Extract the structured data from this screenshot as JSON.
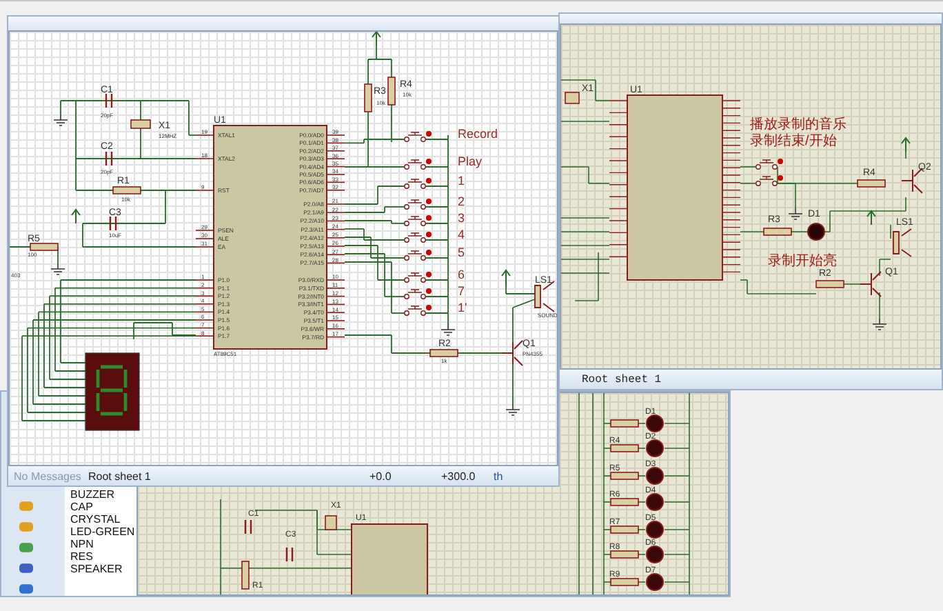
{
  "front_window": {
    "labels": [
      "C1",
      "20pF",
      "C2",
      "20pF",
      "X1",
      "12MHZ",
      "R1",
      "10k",
      "C3",
      "10uF",
      "R5",
      "100",
      "403",
      "R3",
      "10k",
      "R4",
      "10k",
      "U1",
      "AT89C51",
      "R2",
      "1k",
      "Q1",
      "PN4355",
      "LS1",
      "SOUND"
    ],
    "chip": {
      "left_pins": [
        {
          "name": "XTAL1",
          "number": "19"
        },
        {
          "name": "XTAL2",
          "number": "18"
        },
        {
          "name": "RST",
          "number": "9"
        },
        {
          "name": "PSEN",
          "number": "29"
        },
        {
          "name": "ALE",
          "number": "30"
        },
        {
          "name": "EA",
          "number": "31"
        },
        {
          "name": "P1.0",
          "number": "1"
        },
        {
          "name": "P1.1",
          "number": "2"
        },
        {
          "name": "P1.2",
          "number": "3"
        },
        {
          "name": "P1.3",
          "number": "4"
        },
        {
          "name": "P1.4",
          "number": "5"
        },
        {
          "name": "P1.5",
          "number": "6"
        },
        {
          "name": "P1.6",
          "number": "7"
        },
        {
          "name": "P1.7",
          "number": "8"
        }
      ],
      "right_pins": [
        {
          "name": "P0.0/AD0",
          "number": "39"
        },
        {
          "name": "P0.1/AD1",
          "number": "38"
        },
        {
          "name": "P0.2/AD2",
          "number": "37"
        },
        {
          "name": "P0.3/AD3",
          "number": "36"
        },
        {
          "name": "P0.4/AD4",
          "number": "35"
        },
        {
          "name": "P0.5/AD5",
          "number": "34"
        },
        {
          "name": "P0.6/AD6",
          "number": "33"
        },
        {
          "name": "P0.7/AD7",
          "number": "32"
        },
        {
          "name": "P2.0/A8",
          "number": "21"
        },
        {
          "name": "P2.1/A9",
          "number": "22"
        },
        {
          "name": "P2.2/A10",
          "number": "23"
        },
        {
          "name": "P2.3/A11",
          "number": "24"
        },
        {
          "name": "P2.4/A12",
          "number": "25"
        },
        {
          "name": "P2.5/A13",
          "number": "26"
        },
        {
          "name": "P2.6/A14",
          "number": "27"
        },
        {
          "name": "P2.7/A15",
          "number": "28"
        },
        {
          "name": "P3.0/RXD",
          "number": "10"
        },
        {
          "name": "P3.1/TXD",
          "number": "11"
        },
        {
          "name": "P3.2/INT0",
          "number": "12"
        },
        {
          "name": "P3.3/INT1",
          "number": "13"
        },
        {
          "name": "P3.4/T0",
          "number": "14"
        },
        {
          "name": "P3.5/T1",
          "number": "15"
        },
        {
          "name": "P3.6/WR",
          "number": "16"
        },
        {
          "name": "P3.7/RD",
          "number": "17"
        }
      ]
    },
    "buttons": [
      "Record",
      "Play",
      "1",
      "2",
      "3",
      "4",
      "5",
      "6",
      "7",
      "1'"
    ],
    "status_bar": {
      "message": "No Messages",
      "sheet": "Root sheet 1",
      "x": "+0.0",
      "y": "+300.0",
      "unit": "th"
    }
  },
  "back_window": {
    "notes": [
      "播放录制的音乐",
      "录制结束/开始",
      "录制开始亮"
    ],
    "labels": [
      "X1",
      "U1",
      "R4",
      "Q2",
      "R3",
      "D1",
      "LS1",
      "R2",
      "Q1"
    ],
    "status_bar": {
      "sheet": "Root sheet 1"
    }
  },
  "bottom_window": {
    "devices": [
      "BUZZER",
      "CAP",
      "CRYSTAL",
      "LED-GREEN",
      "NPN",
      "RES",
      "SPEAKER"
    ],
    "labels": [
      "C1",
      "X1",
      "C3",
      "U1",
      "R1",
      "D1",
      "D2",
      "D3",
      "D4",
      "D5",
      "D6",
      "D7",
      "R4",
      "R5",
      "R6",
      "R7",
      "R8",
      "R9"
    ]
  }
}
